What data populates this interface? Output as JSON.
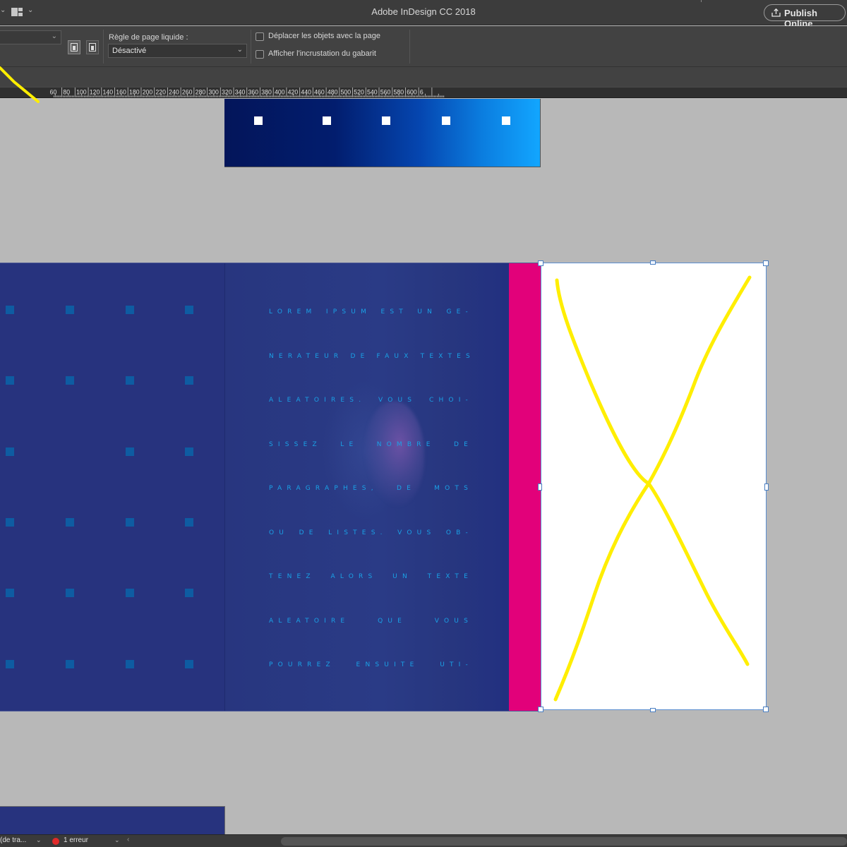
{
  "app": {
    "window_title": "Adobe InDesign CC 2018",
    "publish_label": "Publish Online"
  },
  "control_bar": {
    "liquid_rule_label": "Règle de page liquide :",
    "liquid_rule_value": "Désactivé",
    "move_objects_label": "Déplacer les objets avec la page",
    "move_objects_checked": false,
    "show_master_overlay_label": "Afficher l'incrustation du gabarit",
    "show_master_overlay_checked": false
  },
  "ruler": {
    "labels": [
      "60",
      "80",
      "100",
      "120",
      "140",
      "160",
      "180",
      "200",
      "220",
      "240",
      "260",
      "280",
      "300",
      "320",
      "340",
      "360",
      "380",
      "400",
      "420",
      "440",
      "460",
      "480",
      "500",
      "520",
      "540",
      "560",
      "580",
      "600",
      "6"
    ]
  },
  "document": {
    "lorem_lines": [
      "LOREM IPSUM EST UN GÉ-",
      "NÉRATEUR DE FAUX TEXTES",
      "ALÉATOIRES. VOUS CHOI-",
      "SISSEZ LE NOMBRE DE",
      "PARAGRAPHES, DE MOTS",
      "OU DE LISTES. VOUS OB-",
      "TENEZ ALORS UN TEXTE",
      "ALÉATOIRE QUE VOUS",
      "POURREZ ENSUITE UTI-"
    ],
    "colors": {
      "spread_blue": "#27337e",
      "accent_pink": "#e2017a",
      "text_cyan": "#1aa1e6",
      "annotation_yellow": "#ffee00",
      "pasteboard": "#b8b8b8"
    }
  },
  "status_bar": {
    "mode_label": "(de tra...",
    "error_label": "1 erreur"
  }
}
